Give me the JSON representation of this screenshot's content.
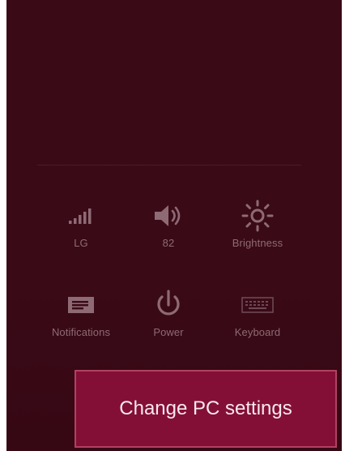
{
  "settings_pane": {
    "quick_settings": [
      {
        "label": "LG",
        "icon": "wifi-signal-icon"
      },
      {
        "label": "82",
        "icon": "volume-icon"
      },
      {
        "label": "Brightness",
        "icon": "brightness-icon"
      },
      {
        "label": "Notifications",
        "icon": "notifications-icon"
      },
      {
        "label": "Power",
        "icon": "power-icon"
      },
      {
        "label": "Keyboard",
        "icon": "keyboard-icon"
      }
    ],
    "change_pc_settings_label": "Change PC settings"
  },
  "colors": {
    "pane_background": "#3a0a16",
    "icon_color": "#8e6b74",
    "button_background": "#840f36",
    "button_border": "#b14163"
  }
}
